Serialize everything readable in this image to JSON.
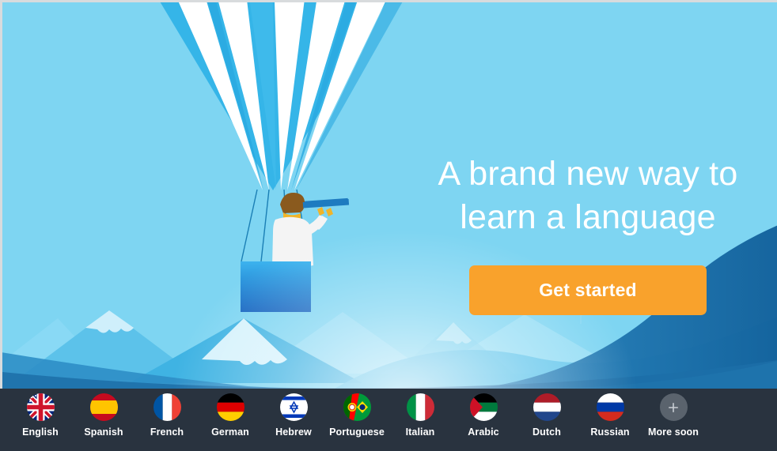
{
  "hero": {
    "headline_line1": "A brand new way to",
    "headline_line2": "learn a language",
    "cta_label": "Get started",
    "colors": {
      "sky": "#7ed5f2",
      "balloon_blue": "#35b5e8",
      "balloon_white": "#ffffff",
      "basket_top": "#3cb3ee",
      "basket_bottom": "#1464c0",
      "cta_orange": "#f9a22c",
      "bar_dark": "#29333f",
      "hill_dark": "#1a6fa8",
      "hill_mid": "#2f9fd8",
      "hill_light": "#8cd9f4"
    },
    "illustration": {
      "name": "hot-air-balloon-with-explorer",
      "figure_hair": "#8a5a1e",
      "figure_shirt": "#f4f4f4",
      "figure_hand": "#f0b429",
      "telescope": "#1e7bc0"
    }
  },
  "language_bar": {
    "items": [
      {
        "label": "English",
        "flag": "flag-english-icon"
      },
      {
        "label": "Spanish",
        "flag": "flag-spanish-icon"
      },
      {
        "label": "French",
        "flag": "flag-french-icon"
      },
      {
        "label": "German",
        "flag": "flag-german-icon"
      },
      {
        "label": "Hebrew",
        "flag": "flag-hebrew-icon"
      },
      {
        "label": "Portuguese",
        "flag": "flag-portuguese-icon"
      },
      {
        "label": "Italian",
        "flag": "flag-italian-icon"
      },
      {
        "label": "Arabic",
        "flag": "flag-arabic-icon"
      },
      {
        "label": "Dutch",
        "flag": "flag-dutch-icon"
      },
      {
        "label": "Russian",
        "flag": "flag-russian-icon"
      },
      {
        "label": "More soon",
        "flag": "plus-icon"
      }
    ]
  }
}
